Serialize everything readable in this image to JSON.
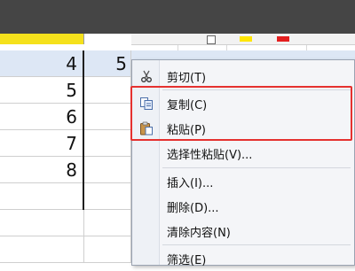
{
  "sheet": {
    "rows": [
      {
        "a": "4",
        "b": "5",
        "selected": true
      },
      {
        "a": "5",
        "b": "",
        "selected": false
      },
      {
        "a": "6",
        "b": "",
        "selected": false
      },
      {
        "a": "7",
        "b": "",
        "selected": false
      },
      {
        "a": "8",
        "b": "",
        "selected": false
      }
    ]
  },
  "context_menu": {
    "items": [
      {
        "label": "剪切(T)",
        "icon": "scissors-icon"
      },
      {
        "label": "复制(C)",
        "icon": "copy-icon"
      },
      {
        "label": "粘贴(P)",
        "icon": "paste-icon"
      },
      {
        "label": "选择性粘贴(V)...",
        "icon": ""
      },
      {
        "label": "插入(I)...",
        "icon": ""
      },
      {
        "label": "删除(D)...",
        "icon": ""
      },
      {
        "label": "清除内容(N)",
        "icon": ""
      },
      {
        "label": "筛选(E)",
        "icon": ""
      }
    ]
  },
  "colors": {
    "highlight_border": "#e5312f",
    "selection_fill": "#dde7f5",
    "toolbar_yellow": "#ffe600",
    "toolbar_red": "#e41f1f"
  }
}
